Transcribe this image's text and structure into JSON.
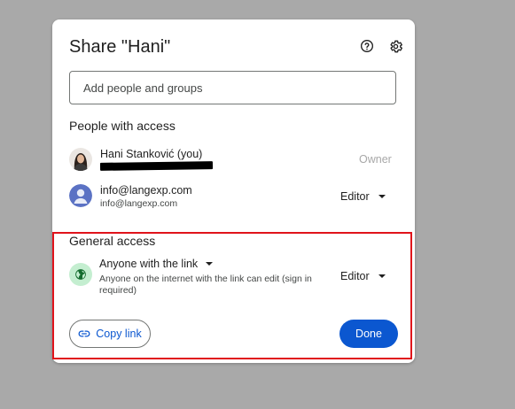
{
  "dialog": {
    "title": "Share \"Hani\"",
    "help_icon": "help-circle-icon",
    "settings_icon": "gear-icon"
  },
  "add_people": {
    "placeholder": "Add people and groups"
  },
  "people_with_access": {
    "title": "People with access",
    "people": [
      {
        "name": "Hani Stanković (you)",
        "role": "Owner"
      },
      {
        "name": "info@langexp.com",
        "email": "info@langexp.com",
        "role": "Editor"
      }
    ]
  },
  "general_access": {
    "title": "General access",
    "link_setting": "Anyone with the link",
    "description": "Anyone on the internet with the link can edit (sign in required)",
    "role": "Editor"
  },
  "actions": {
    "copy_link": "Copy link",
    "done": "Done"
  },
  "colors": {
    "primary": "#0b57d0",
    "highlight_border": "#e0131b",
    "globe_bg": "#c4eed0"
  }
}
